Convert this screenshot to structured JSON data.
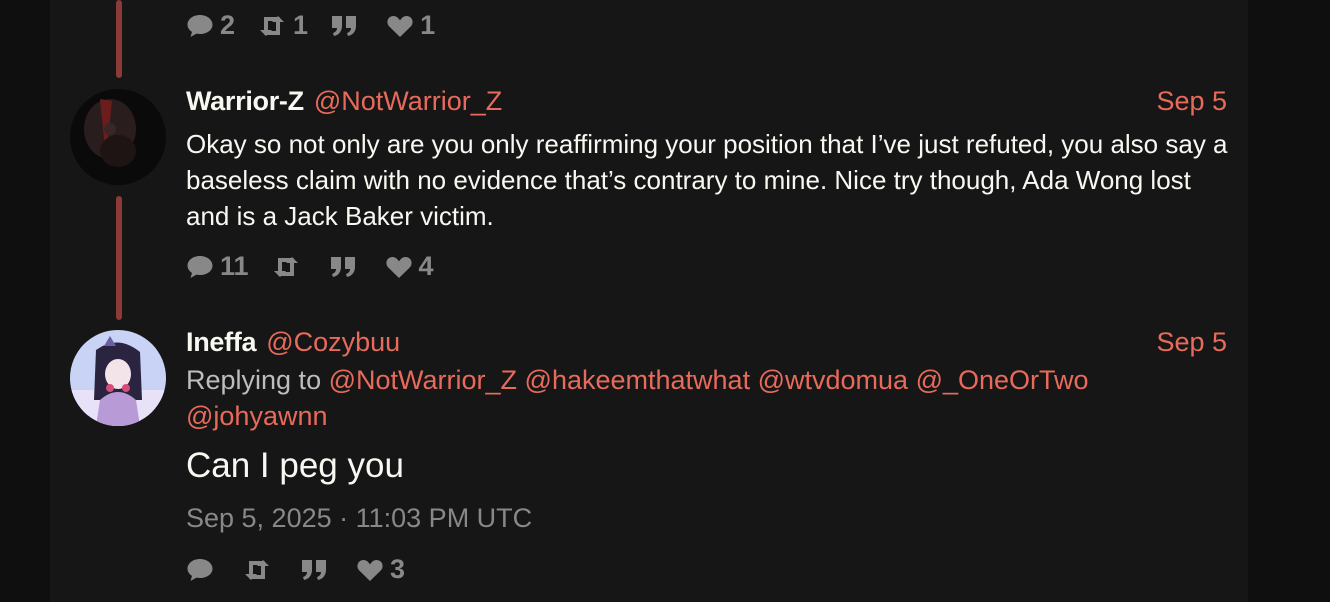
{
  "top_stats": {
    "replies": "2",
    "retweets": "1",
    "quotes": "",
    "likes": "1"
  },
  "tweet1": {
    "fullname": "Warrior-Z",
    "username": "@NotWarrior_Z",
    "date": "Sep 5",
    "content": "Okay so not only are you only reaffirming your position that I’ve just refuted, you also say a baseless claim with no evidence that’s contrary to mine. Nice try though, Ada Wong lost and is a Jack Baker victim.",
    "stats": {
      "replies": "11",
      "retweets": "",
      "quotes": "",
      "likes": "4"
    }
  },
  "tweet2": {
    "fullname": "Ineffa",
    "username": "@Cozybuu",
    "date": "Sep 5",
    "replying_label": "Replying to",
    "mentions": [
      "@NotWarrior_Z",
      "@hakeemthatwhat",
      "@wtvdomua",
      "@_OneOrTwo",
      "@johyawnn"
    ],
    "content": "Can I peg you",
    "timestamp": "Sep 5, 2025 · 11:03 PM UTC",
    "stats": {
      "replies": "",
      "retweets": "",
      "quotes": "",
      "likes": "3"
    }
  },
  "colors": {
    "accent": "#e86a5b",
    "thread_line": "#8c3a37",
    "icon": "#888888"
  }
}
